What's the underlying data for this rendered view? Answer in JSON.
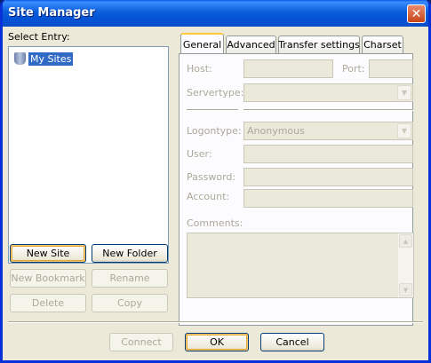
{
  "window": {
    "title": "Site Manager"
  },
  "tree": {
    "label": "Select Entry:",
    "items": [
      {
        "label": "My Sites"
      }
    ]
  },
  "buttons": {
    "new_site": "New Site",
    "new_folder": "New Folder",
    "new_bookmark": "New Bookmark",
    "rename": "Rename",
    "delete": "Delete",
    "copy": "Copy",
    "connect": "Connect",
    "ok": "OK",
    "cancel": "Cancel"
  },
  "tabs": [
    {
      "label": "General",
      "active": true
    },
    {
      "label": "Advanced"
    },
    {
      "label": "Transfer settings"
    },
    {
      "label": "Charset"
    }
  ],
  "general": {
    "host_label": "Host:",
    "host_value": "",
    "port_label": "Port:",
    "port_value": "",
    "servertype_label": "Servertype:",
    "servertype_value": "",
    "logontype_label": "Logontype:",
    "logontype_value": "Anonymous",
    "user_label": "User:",
    "password_label": "Password:",
    "account_label": "Account:",
    "comments_label": "Comments:"
  },
  "icons": {
    "close": "close-icon",
    "folder": "server-folder-icon",
    "dropdown": "chevron-down-icon",
    "scroll_up": "scroll-up-icon",
    "scroll_down": "scroll-down-icon"
  },
  "colors": {
    "titlebar": "#0a5ed8",
    "selection": "#316ac5",
    "window_bg": "#ece9d8",
    "active_tab_accent": "#ffc83c"
  }
}
